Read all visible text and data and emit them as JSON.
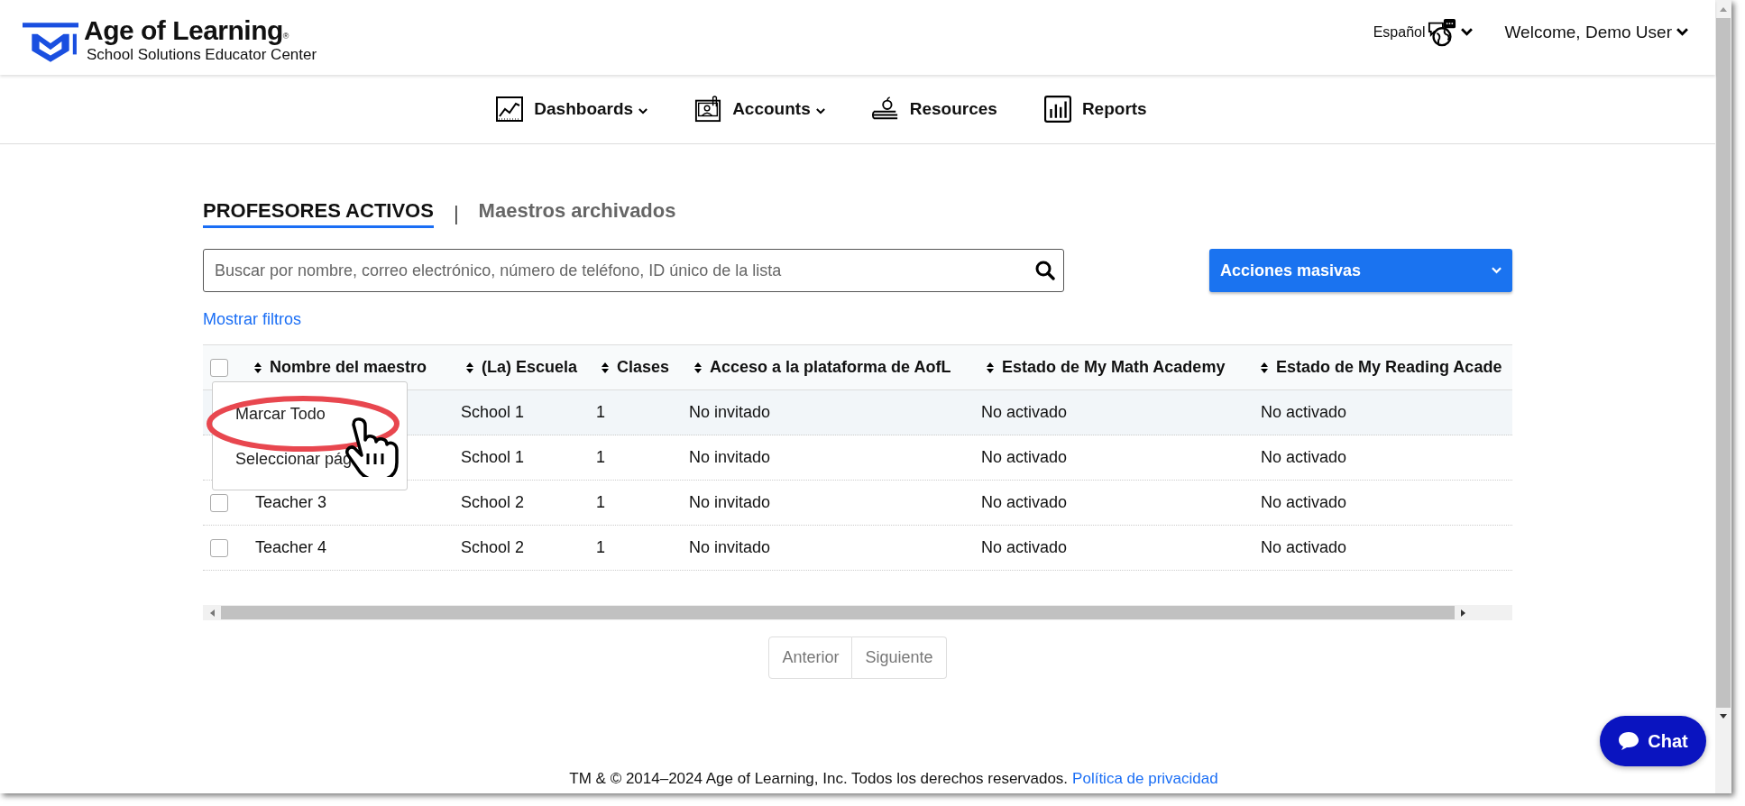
{
  "header": {
    "brand": "Age of Learning",
    "trademark": "®",
    "subtitle": "School Solutions Educator Center",
    "language": "Español",
    "welcome": "Welcome, Demo User"
  },
  "nav": [
    {
      "label": "Dashboards",
      "dropdown": true
    },
    {
      "label": "Accounts",
      "dropdown": true
    },
    {
      "label": "Resources",
      "dropdown": false
    },
    {
      "label": "Reports",
      "dropdown": false
    }
  ],
  "tabs": [
    {
      "label": "PROFESORES ACTIVOS",
      "selected": true
    },
    {
      "label": "Maestros archivados",
      "selected": false
    }
  ],
  "tab_separator": "|",
  "search": {
    "placeholder": "Buscar por nombre, correo electrónico, número de teléfono, ID único de la lista"
  },
  "bulk_actions": {
    "label": "Acciones masivas"
  },
  "filters_link": "Mostrar filtros",
  "table": {
    "select_all_checked": false,
    "columns": [
      "Nombre del maestro",
      "(La) Escuela",
      "Clases",
      "Acceso a la plataforma de AofL",
      "Estado de My Math Academy",
      "Estado de My Reading Acade"
    ],
    "rows": [
      {
        "highlighted": true,
        "school": "School 1",
        "classes": "1",
        "access": "No invitado",
        "math": "No activado",
        "reading": "No activado"
      },
      {
        "highlighted": false,
        "school": "School 1",
        "classes": "1",
        "access": "No invitado",
        "math": "No activado",
        "reading": "No activado"
      },
      {
        "checked": false,
        "highlighted": false,
        "teacher": "Teacher 3",
        "school": "School 2",
        "classes": "1",
        "access": "No invitado",
        "math": "No activado",
        "reading": "No activado"
      },
      {
        "checked": false,
        "highlighted": false,
        "teacher": "Teacher 4",
        "school": "School 2",
        "classes": "1",
        "access": "No invitado",
        "math": "No activado",
        "reading": "No activado"
      }
    ]
  },
  "select_menu": {
    "items": [
      {
        "label": "Marcar Todo",
        "circled": true
      },
      {
        "label": "Seleccionar pág",
        "circled": false
      }
    ]
  },
  "pagination": [
    {
      "label": "Anterior",
      "disabled": true
    },
    {
      "label": "Siguiente",
      "disabled": true
    }
  ],
  "footer": {
    "text": "TM & © 2014–2024 Age of Learning, Inc. Todos los derechos reservados.",
    "link": "Política de privacidad"
  },
  "chat": {
    "label": "Chat"
  }
}
